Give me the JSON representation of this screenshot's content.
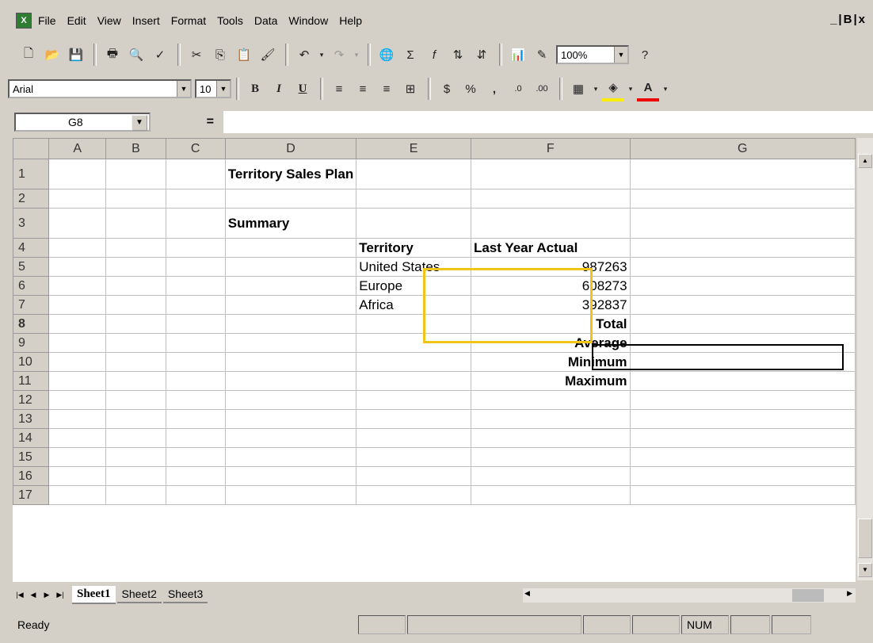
{
  "menubar": {
    "items": [
      "File",
      "Edit",
      "View",
      "Insert",
      "Format",
      "Tools",
      "Data",
      "Window",
      "Help"
    ],
    "window_controls": "_|B|x"
  },
  "toolbar1": {
    "icons": [
      "new-icon",
      "open-icon",
      "save-icon",
      "print-icon",
      "print-preview-icon",
      "spelling-icon",
      "cut-icon",
      "copy-icon",
      "paste-icon",
      "format-painter-icon",
      "undo-icon",
      "redo-icon",
      "hyperlink-icon",
      "autosum-icon",
      "function-icon",
      "sort-ascending-icon",
      "sort-descending-icon",
      "chart-wizard-icon",
      "drawing-icon"
    ],
    "zoom": "100%"
  },
  "toolbar2": {
    "font": "Arial",
    "font_size": "10",
    "bold": "B",
    "italic": "I",
    "underline": "U",
    "percent": "%",
    "comma": ","
  },
  "formula_bar": {
    "name_box": "G8",
    "equals": "=",
    "content": ""
  },
  "columns": [
    "A",
    "B",
    "C",
    "D",
    "E",
    "F",
    "G"
  ],
  "rows": [
    {
      "n": "1",
      "D": "Territory Sales Plan",
      "E": "",
      "F": ""
    },
    {
      "n": "2",
      "D": "",
      "E": "",
      "F": ""
    },
    {
      "n": "3",
      "D": "Summary",
      "E": "",
      "F": ""
    },
    {
      "n": "4",
      "D": "",
      "E": "Territory",
      "F": "Last Year Actual"
    },
    {
      "n": "5",
      "D": "",
      "E": "United States",
      "F": "987263"
    },
    {
      "n": "6",
      "D": "",
      "E": "Europe",
      "F": "608273"
    },
    {
      "n": "7",
      "D": "",
      "E": "Africa",
      "F": "392837"
    },
    {
      "n": "8",
      "D": "",
      "E": "",
      "F": "Total"
    },
    {
      "n": "9",
      "D": "",
      "E": "",
      "F": "Average"
    },
    {
      "n": "10",
      "D": "",
      "E": "",
      "F": "Minimum"
    },
    {
      "n": "11",
      "D": "",
      "E": "",
      "F": "Maximum"
    },
    {
      "n": "12",
      "D": "",
      "E": "",
      "F": ""
    },
    {
      "n": "13",
      "D": "",
      "E": "",
      "F": ""
    },
    {
      "n": "14",
      "D": "",
      "E": "",
      "F": ""
    },
    {
      "n": "15",
      "D": "",
      "E": "",
      "F": ""
    },
    {
      "n": "16",
      "D": "",
      "E": "",
      "F": ""
    },
    {
      "n": "17",
      "D": "",
      "E": "",
      "F": ""
    }
  ],
  "sheet_tabs": [
    "Sheet1",
    "Sheet2",
    "Sheet3"
  ],
  "active_sheet": "Sheet1",
  "status": {
    "mode": "Ready",
    "num": "NUM"
  },
  "colors": {
    "selection_highlight": "#f0c419",
    "chrome": "#d4d0c8"
  }
}
